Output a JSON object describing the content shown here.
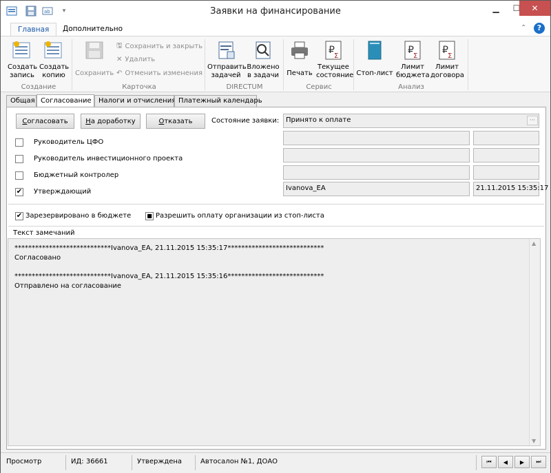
{
  "window": {
    "title": "Заявки на финансирование",
    "minimize_icon": "minimize-icon",
    "maximize_icon": "maximize-icon",
    "close_icon": "close-icon"
  },
  "quick_access": [
    "app-menu-icon",
    "save-icon",
    "field-icon",
    "customize-arrow-icon"
  ],
  "ribbon_tabs": [
    {
      "label": "Главная",
      "active": true
    },
    {
      "label": "Дополнительно",
      "active": false
    }
  ],
  "ribbon": {
    "create_record": "Создать запись",
    "create_record_l1": "Создать",
    "create_record_l2": "запись",
    "create_copy_l1": "Создать",
    "create_copy_l2": "копию",
    "group_create": "Создание",
    "save": "Сохранить",
    "save_and_close": "Сохранить и закрыть",
    "delete": "Удалить",
    "undo_changes": "Отменить изменения",
    "group_card": "Карточка",
    "send_task_l1": "Отправить",
    "send_task_l2": "задачей",
    "attach_task_l1": "Вложено",
    "attach_task_l2": "в задачи",
    "group_directum": "DIRECTUM",
    "print": "Печать",
    "current_state_l1": "Текущее",
    "current_state_l2": "состояние",
    "group_service": "Сервис",
    "stop_list": "Стоп-лист",
    "budget_limit_l1": "Лимит",
    "budget_limit_l2": "бюджета",
    "contract_limit_l1": "Лимит",
    "contract_limit_l2": "договора",
    "group_analysis": "Анализ"
  },
  "tabs": [
    {
      "label": "Общая",
      "active": false
    },
    {
      "label": "Согласование",
      "active": true
    },
    {
      "label": "Налоги и отчисления",
      "active": false
    },
    {
      "label": "Платежный календарь",
      "active": false
    }
  ],
  "approval": {
    "approve_button": "Согласовать",
    "approve_button_underline": "С",
    "approve_button_rest": "огласовать",
    "rework_button": "На доработку",
    "rework_button_underline": "Н",
    "rework_button_rest": "а доработку",
    "reject_button": "Отказать",
    "reject_button_underline": "О",
    "reject_button_rest": "тказать",
    "state_label": "Состояние заявки:",
    "state_value": "Принято к оплате",
    "ellipsis": "···",
    "rows": [
      {
        "label": "Руководитель ЦФО",
        "checked": false,
        "user": "",
        "date": ""
      },
      {
        "label": "Руководитель инвестиционного проекта",
        "checked": false,
        "user": "",
        "date": ""
      },
      {
        "label": "Бюджетный контролер",
        "checked": false,
        "user": "",
        "date": ""
      },
      {
        "label": "Утверждающий",
        "checked": true,
        "user": "Ivanova_EA",
        "date": "21.11.2015 15:35:17"
      }
    ],
    "reserved_in_budget": {
      "label": "Зарезервировано в бюджете",
      "checked": true
    },
    "allow_stoplist_payment": {
      "label": "Разрешить оплату организации из стоп-листа",
      "checked": true
    },
    "check_mark": "✔",
    "check_square": "■"
  },
  "remarks": {
    "label": "Текст замечаний",
    "lines": [
      "****************************Ivanova_EA, 21.11.2015 15:35:17****************************",
      "Согласовано",
      "",
      "****************************Ivanova_EA, 21.11.2015 15:35:16****************************",
      "Отправлено на согласование"
    ]
  },
  "statusbar": {
    "mode": "Просмотр",
    "id": "ИД: 36661",
    "state": "Утверждена",
    "org": "Автосалон №1, ДОАО",
    "nav_first": "⏮",
    "nav_prev": "◀",
    "nav_next": "▶",
    "nav_last": "⏭"
  },
  "colors": {
    "accent": "#1a5aa8",
    "close_button": "#c75050",
    "field_bg": "#eeeeee"
  }
}
